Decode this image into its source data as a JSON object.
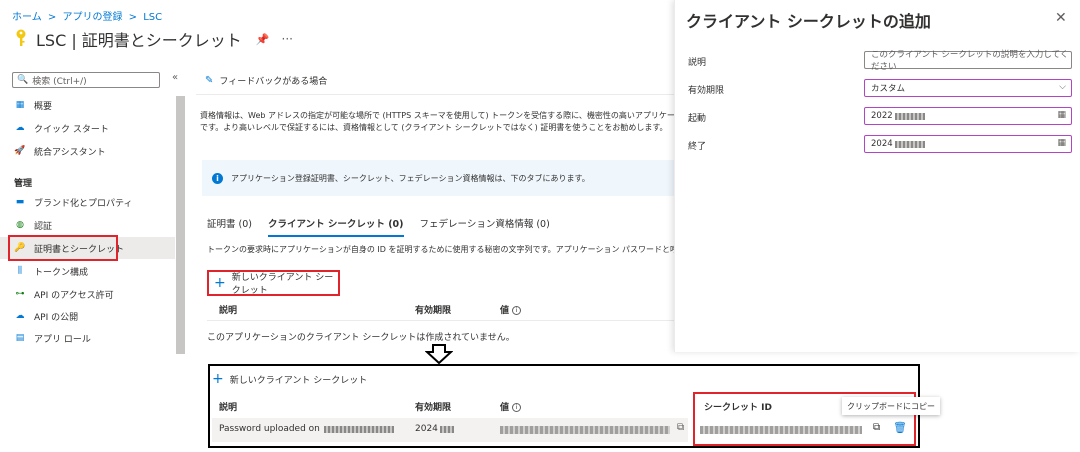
{
  "breadcrumb": [
    "ホーム",
    ">",
    "アプリの登録",
    ">",
    "LSC"
  ],
  "page_title": "LSC | 証明書とシークレット",
  "search": {
    "placeholder": "検索 (Ctrl+/)"
  },
  "sidebar": {
    "items": [
      {
        "label": "概要",
        "icon": "grid-icon"
      },
      {
        "label": "クイック スタート",
        "icon": "cloud-icon"
      },
      {
        "label": "統合アシスタント",
        "icon": "rocket-icon"
      }
    ],
    "section": "管理",
    "manage_items": [
      {
        "label": "ブランド化とプロパティ",
        "icon": "branding-icon"
      },
      {
        "label": "認証",
        "icon": "auth-icon"
      },
      {
        "label": "証明書とシークレット",
        "icon": "key-icon",
        "active": true
      },
      {
        "label": "トークン構成",
        "icon": "token-icon"
      },
      {
        "label": "API のアクセス許可",
        "icon": "api-permission-icon"
      },
      {
        "label": "API の公開",
        "icon": "cloud-api-icon"
      },
      {
        "label": "アプリ ロール",
        "icon": "app-role-icon"
      }
    ]
  },
  "main": {
    "feedback": "フィードバックがある場合",
    "desc_line1": "資格情報は、Web アドレスの指定が可能な場所で (HTTPS スキーマを使用して) トークンを受信する際に、機密性の高いアプリケーシ",
    "desc_line2": "です。より高いレベルで保証するには、資格情報として (クライアント シークレットではなく) 証明書を使うことをお勧めします。",
    "info": "アプリケーション登録証明書、シークレット、フェデレーション資格情報は、下のタブにあります。",
    "tabs": [
      "証明書 (0)",
      "クライアント シークレット (0)",
      "フェデレーション資格情報 (0)"
    ],
    "tab_desc": "トークンの要求時にアプリケーションが自身の ID を証明するために使用する秘密の文字列です。アプリケーション パスワードと呼ばれる",
    "new_secret": "新しいクライアント シークレット",
    "col_desc": "説明",
    "col_exp": "有効期限",
    "col_val": "値",
    "empty": "このアプリケーションのクライアント シークレットは作成されていません。"
  },
  "panel": {
    "title": "クライアント シークレットの追加",
    "desc_label": "説明",
    "desc_placeholder": "このクライアント シークレットの説明を入力してください",
    "exp_label": "有効期限",
    "exp_value": "カスタム",
    "start_label": "起動",
    "start_value": "2022",
    "end_label": "終了",
    "end_value": "2024"
  },
  "bottom": {
    "new_secret": "新しいクライアント シークレット",
    "col_desc": "説明",
    "col_exp": "有効期限",
    "col_val": "値",
    "col_secret": "シークレット ID",
    "row_desc": "Password uploaded on",
    "row_exp": "2024",
    "tooltip": "クリップボードにコピー"
  },
  "colors": {
    "accent": "#0078d4",
    "highlight": "#e0242b",
    "focus": "#b146c2"
  }
}
